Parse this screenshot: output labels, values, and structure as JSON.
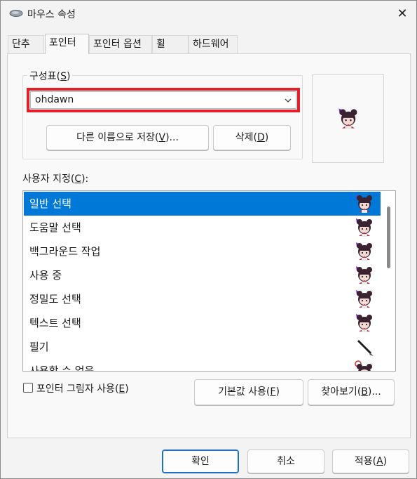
{
  "window": {
    "title": "마우스 속성",
    "icon": "mouse-icon",
    "close_label": "✕"
  },
  "tabs": [
    {
      "label": "단추",
      "active": false
    },
    {
      "label": "포인터",
      "active": true
    },
    {
      "label": "포인터 옵션",
      "active": false
    },
    {
      "label": "휠",
      "active": false
    },
    {
      "label": "하드웨어",
      "active": false
    }
  ],
  "scheme": {
    "group_label_pre": "구성표(",
    "group_label_key": "S",
    "group_label_post": ")",
    "selected": "ohdawn",
    "save_as_pre": "다른 이름으로 저장(",
    "save_as_key": "V",
    "save_as_post": ")...",
    "delete_pre": "삭제(",
    "delete_key": "D",
    "delete_post": ")"
  },
  "customize": {
    "label_pre": "사용자 지정(",
    "label_key": "C",
    "label_post": "):",
    "items": [
      {
        "label": "일반 선택",
        "icon": "chibi-cursor-icon",
        "selected": true
      },
      {
        "label": "도움말 선택",
        "icon": "chibi-cursor-icon",
        "selected": false
      },
      {
        "label": "백그라운드 작업",
        "icon": "chibi-cursor-icon",
        "selected": false
      },
      {
        "label": "사용 중",
        "icon": "chibi-cursor-icon",
        "selected": false
      },
      {
        "label": "정밀도 선택",
        "icon": "chibi-cursor-icon",
        "selected": false
      },
      {
        "label": "텍스트 선택",
        "icon": "chibi-cursor-icon",
        "selected": false
      },
      {
        "label": "필기",
        "icon": "pen-cursor-icon",
        "selected": false
      },
      {
        "label": "사용할 수 없음",
        "icon": "chibi-cursor-icon",
        "selected": false
      }
    ]
  },
  "shadow": {
    "checked": false,
    "label_pre": "포인터 그림자 사용(",
    "label_key": "E",
    "label_post": ")"
  },
  "buttons": {
    "default_pre": "기본값 사용(",
    "default_key": "F",
    "default_post": ")",
    "browse_pre": "찾아보기(",
    "browse_key": "B",
    "browse_post": ")...",
    "ok": "확인",
    "cancel": "취소",
    "apply_pre": "적용(",
    "apply_key": "A",
    "apply_post": ")"
  },
  "colors": {
    "selection": "#0078d7",
    "highlight_box": "#e1202a",
    "cursor_hair": "#3a2230",
    "cursor_accent": "#8a2be2"
  }
}
